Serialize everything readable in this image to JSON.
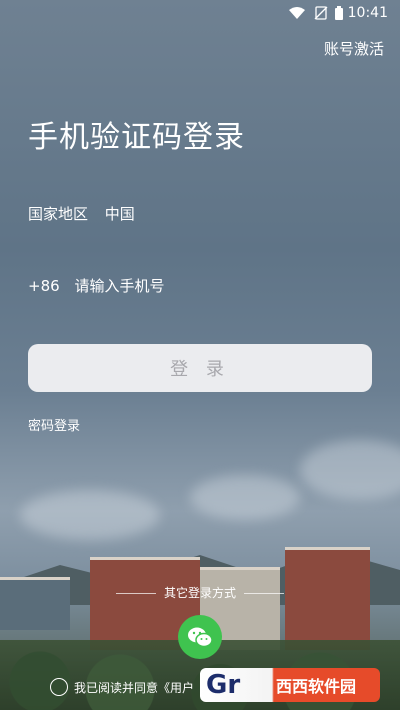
{
  "status_bar": {
    "time": "10:41"
  },
  "header": {
    "activate_label": "账号激活"
  },
  "main": {
    "title": "手机验证码登录",
    "region_label": "国家地区",
    "region_value": "中国",
    "country_code": "+86",
    "phone_placeholder": "请输入手机号",
    "login_label": "登 录",
    "password_login_label": "密码登录"
  },
  "other_login": {
    "label": "其它登录方式"
  },
  "agreement": {
    "text": "我已阅读并同意《用户"
  },
  "watermark": {
    "left": "Gr",
    "right": "西西软件园"
  },
  "colors": {
    "wechat": "#3fc34f",
    "button_bg": "#f0f0f2"
  }
}
